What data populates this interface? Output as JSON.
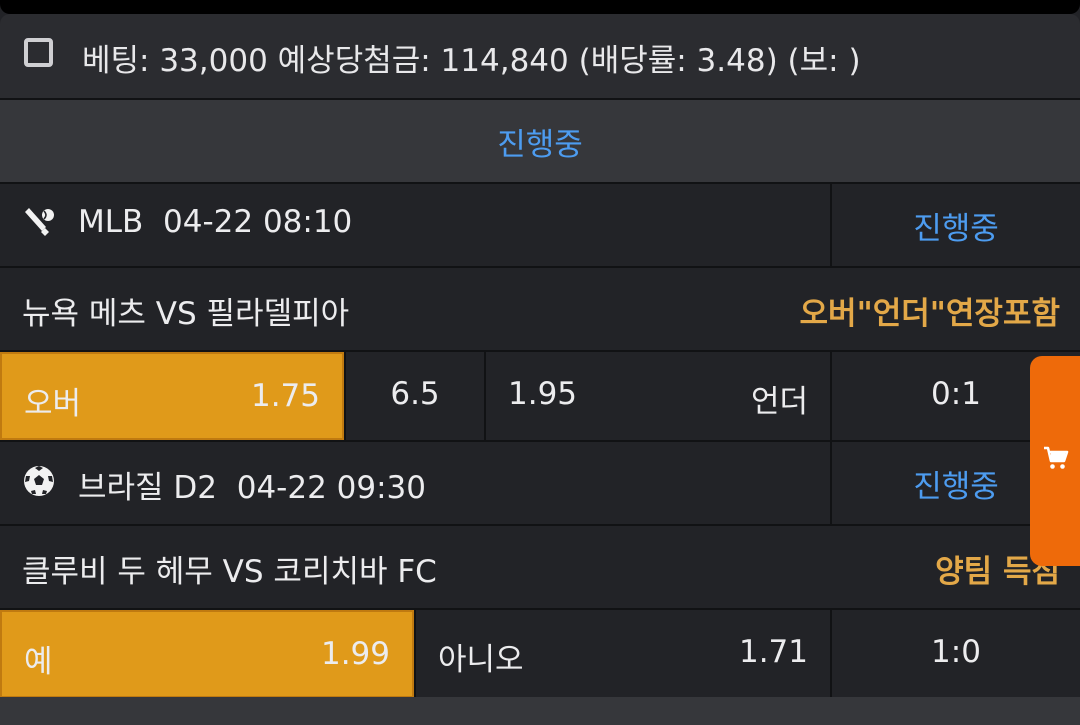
{
  "summary": {
    "text": "베팅: 33,000 예상당첨금: 114,840 (배당률: 3.48) (보: )"
  },
  "status_bar": {
    "label": "진행중"
  },
  "games": [
    {
      "league_icon": "baseball-icon",
      "league": "MLB",
      "datetime": "04-22 08:10",
      "status": "진행중",
      "match": "뉴욕 메츠 VS 필라델피아",
      "market": "오버\"언더\"연장포함",
      "odds": {
        "left_label": "오버",
        "left_value": "1.75",
        "line": "6.5",
        "right_value": "1.95",
        "right_label": "언더",
        "score": "0:1"
      }
    },
    {
      "league_icon": "soccer-ball-icon",
      "league": "브라질 D2",
      "datetime": "04-22 09:30",
      "status": "진행중",
      "match": "클루비 두 헤무 VS 코리치바 FC",
      "market": "양팀 득점",
      "odds": {
        "left_label": "예",
        "left_value": "1.99",
        "right_label": "아니오",
        "right_value": "1.71",
        "score": "1:0"
      }
    }
  ],
  "cart": {
    "icon": "cart-icon",
    "color": "#ee6a0a"
  },
  "colors": {
    "selected": "#e09a1a",
    "status_blue": "#4d9cf0",
    "market_gold": "#e3a848"
  }
}
